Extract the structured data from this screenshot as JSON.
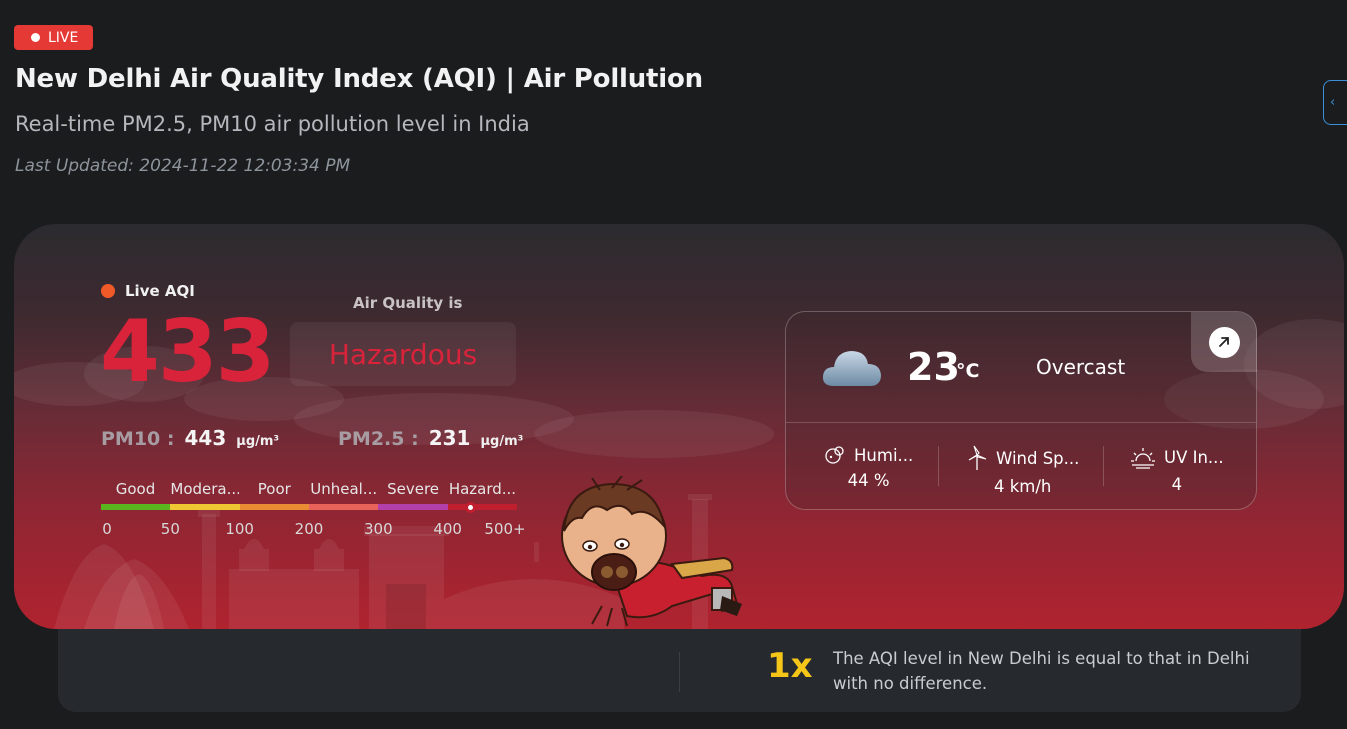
{
  "header": {
    "live_label": "LIVE",
    "title": "New Delhi Air Quality Index (AQI) | Air Pollution",
    "subtitle": "Real-time PM2.5, PM10 air pollution level in India",
    "last_updated": "Last Updated: 2024-11-22 12:03:34 PM"
  },
  "aqi": {
    "live_label": "Live AQI",
    "value": "433",
    "air_quality_label": "Air Quality is",
    "status": "Hazardous",
    "pm10_label": "PM10 :",
    "pm10_value": "443",
    "pm10_unit": "µg/m³",
    "pm25_label": "PM2.5 :",
    "pm25_value": "231",
    "pm25_unit": "µg/m³",
    "marker_value": 433
  },
  "scale": {
    "levels": [
      "Good",
      "Modera...",
      "Poor",
      "Unheal...",
      "Severe",
      "Hazard..."
    ],
    "colors": [
      "#59b61f",
      "#eec732",
      "#ea8c34",
      "#e9635a",
      "#b33faa",
      "#c01f30"
    ],
    "ticks": [
      "0",
      "50",
      "100",
      "200",
      "300",
      "400",
      "500+"
    ]
  },
  "weather": {
    "temperature": "23",
    "unit": "°C",
    "condition": "Overcast",
    "icon": "cloud-icon",
    "humidity_label": "Humi...",
    "humidity_value": "44 %",
    "wind_label": "Wind Sp...",
    "wind_value": "4 km/h",
    "uv_label": "UV In...",
    "uv_value": "4"
  },
  "comparison": {
    "multiplier": "1x",
    "text": "The AQI level in New Delhi is equal to that in Delhi with no difference."
  },
  "colors": {
    "accent_red": "#d8233a",
    "live_red": "#e53935",
    "multiplier_yellow": "#f5c518"
  }
}
